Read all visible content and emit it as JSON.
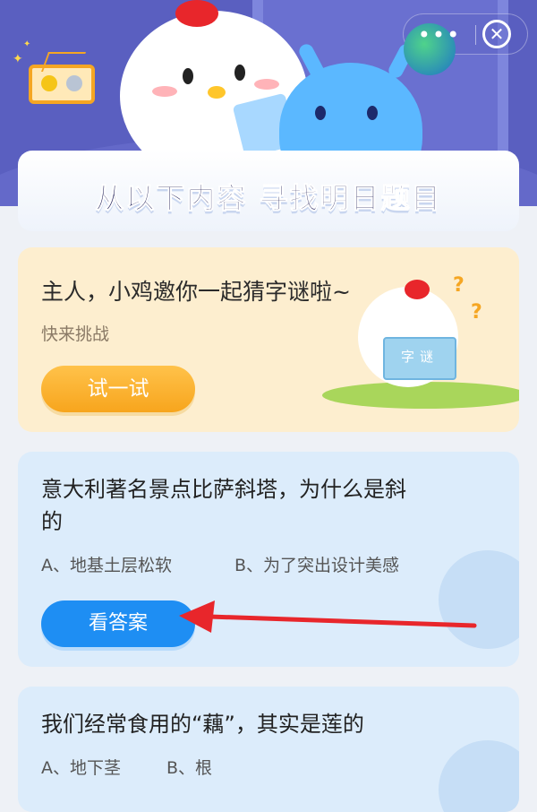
{
  "header": {
    "icons": [
      "sparkle-icon",
      "medal-plaque-icon",
      "more-icon",
      "globe-icon",
      "close-icon"
    ],
    "more_glyph": "•••",
    "close_glyph": "✕",
    "banner_title": "从以下内容 寻找明日题目"
  },
  "riddle_card": {
    "title": "主人，小鸡邀你一起猜字谜啦~",
    "subtitle": "快来挑战",
    "button_label": "试一试",
    "book_text": "字谜"
  },
  "questions": [
    {
      "text_line1": "意大利著名景点比萨斜塔，为什么是斜",
      "text_line2": "的",
      "option_a": "A、地基土层松软",
      "option_b": "B、为了突出设计美感",
      "button_label": "看答案"
    },
    {
      "text_line1": "我们经常食用的“藕”，其实是莲的",
      "option_a": "A、地下茎",
      "option_b": "B、根"
    }
  ],
  "colors": {
    "header_bg": "#5a5fc0",
    "try_button": "#f7a51d",
    "answer_button": "#1e8ef3",
    "arrow": "#e8262b",
    "question_card_bg": "#dcecfb",
    "riddle_card_bg": "#fdeecf"
  }
}
